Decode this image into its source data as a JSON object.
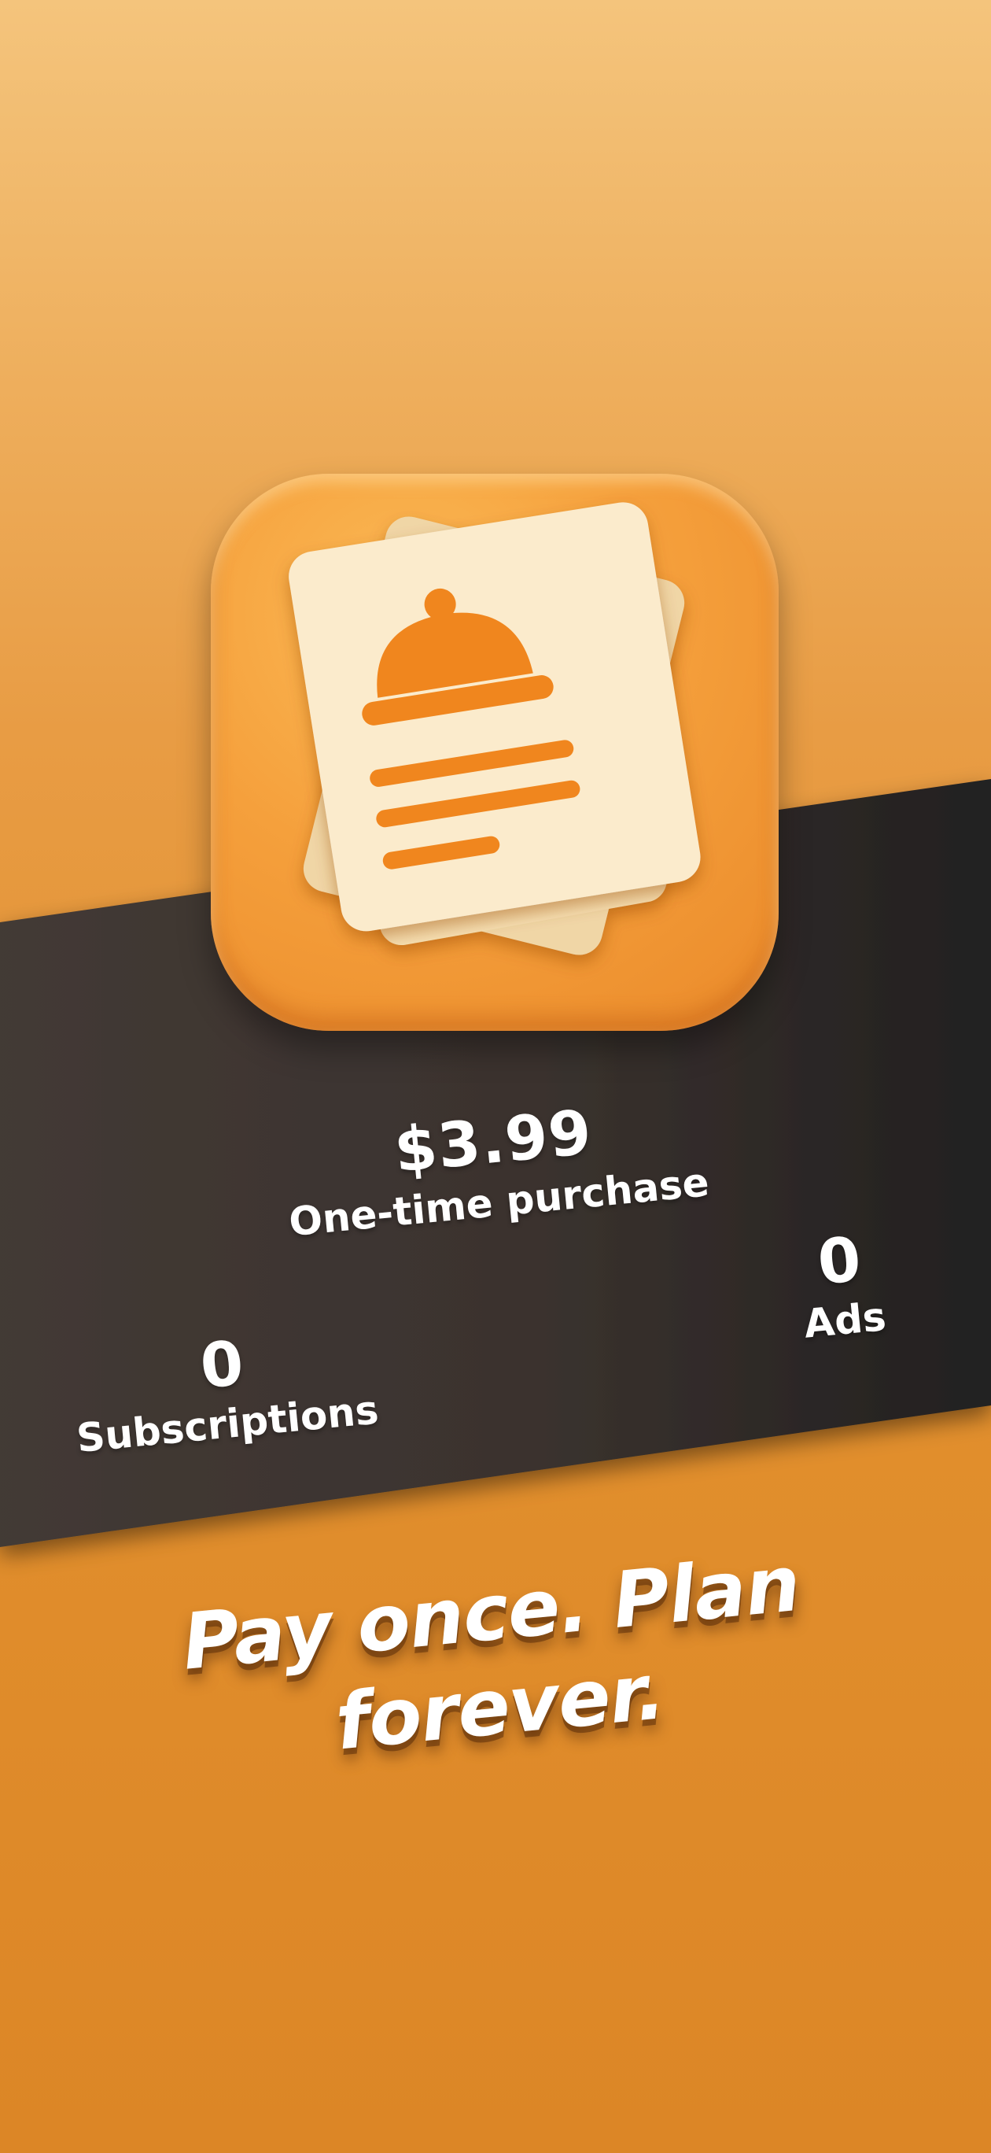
{
  "colors": {
    "background_top": "#f4c47c",
    "background_bottom": "#dc8626",
    "band": "#3a332f",
    "icon_orange": "#f5a03c",
    "paper": "#fbebcc",
    "accent": "#f0861e",
    "text": "#ffffff"
  },
  "app_icon": {
    "name": "menu-document-with-cloche-icon"
  },
  "pricing": {
    "price": "$3.99",
    "price_caption": "One-time purchase",
    "ads_value": "0",
    "ads_caption": "Ads",
    "subscriptions_value": "0",
    "subscriptions_caption": "Subscriptions"
  },
  "tagline": "Pay once. Plan forever."
}
